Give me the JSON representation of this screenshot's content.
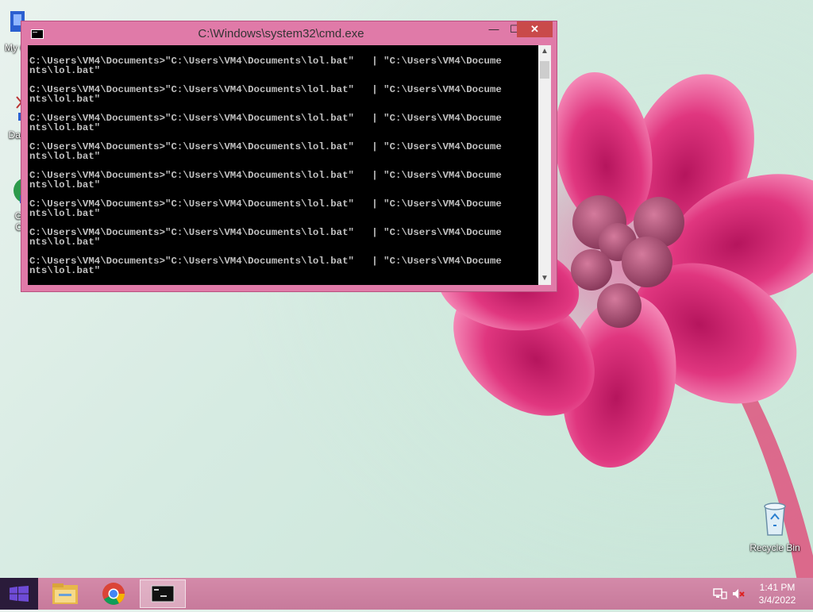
{
  "desktop": {
    "icons": [
      {
        "label": "My C"
      },
      {
        "label": "Data"
      },
      {
        "label": "G\nC"
      },
      {
        "label": "Recycle Bin"
      }
    ]
  },
  "window": {
    "title": "C:\\Windows\\system32\\cmd.exe",
    "minimize_label": "—",
    "maximize_label": "☐",
    "close_label": "✕",
    "console_lines": [
      "C:\\Users\\VM4\\Documents>\"C:\\Users\\VM4\\Documents\\lol.bat\"   | \"C:\\Users\\VM4\\Docume",
      "nts\\lol.bat\"",
      "",
      "C:\\Users\\VM4\\Documents>\"C:\\Users\\VM4\\Documents\\lol.bat\"   | \"C:\\Users\\VM4\\Docume",
      "nts\\lol.bat\"",
      "",
      "C:\\Users\\VM4\\Documents>\"C:\\Users\\VM4\\Documents\\lol.bat\"   | \"C:\\Users\\VM4\\Docume",
      "nts\\lol.bat\"",
      "",
      "C:\\Users\\VM4\\Documents>\"C:\\Users\\VM4\\Documents\\lol.bat\"   | \"C:\\Users\\VM4\\Docume",
      "nts\\lol.bat\"",
      "",
      "C:\\Users\\VM4\\Documents>\"C:\\Users\\VM4\\Documents\\lol.bat\"   | \"C:\\Users\\VM4\\Docume",
      "nts\\lol.bat\"",
      "",
      "C:\\Users\\VM4\\Documents>\"C:\\Users\\VM4\\Documents\\lol.bat\"   | \"C:\\Users\\VM4\\Docume",
      "nts\\lol.bat\"",
      "",
      "C:\\Users\\VM4\\Documents>\"C:\\Users\\VM4\\Documents\\lol.bat\"   | \"C:\\Users\\VM4\\Docume",
      "nts\\lol.bat\"",
      "",
      "C:\\Users\\VM4\\Documents>\"C:\\Users\\VM4\\Documents\\lol.bat\"   | \"C:\\Users\\VM4\\Docume",
      "nts\\lol.bat\""
    ]
  },
  "taskbar": {
    "clock": {
      "time": "1:41 PM",
      "date": "3/4/2022"
    }
  },
  "colors": {
    "window_frame": "#e07aa8",
    "close_button": "#c94a4a",
    "taskbar": "#c77a9b"
  }
}
